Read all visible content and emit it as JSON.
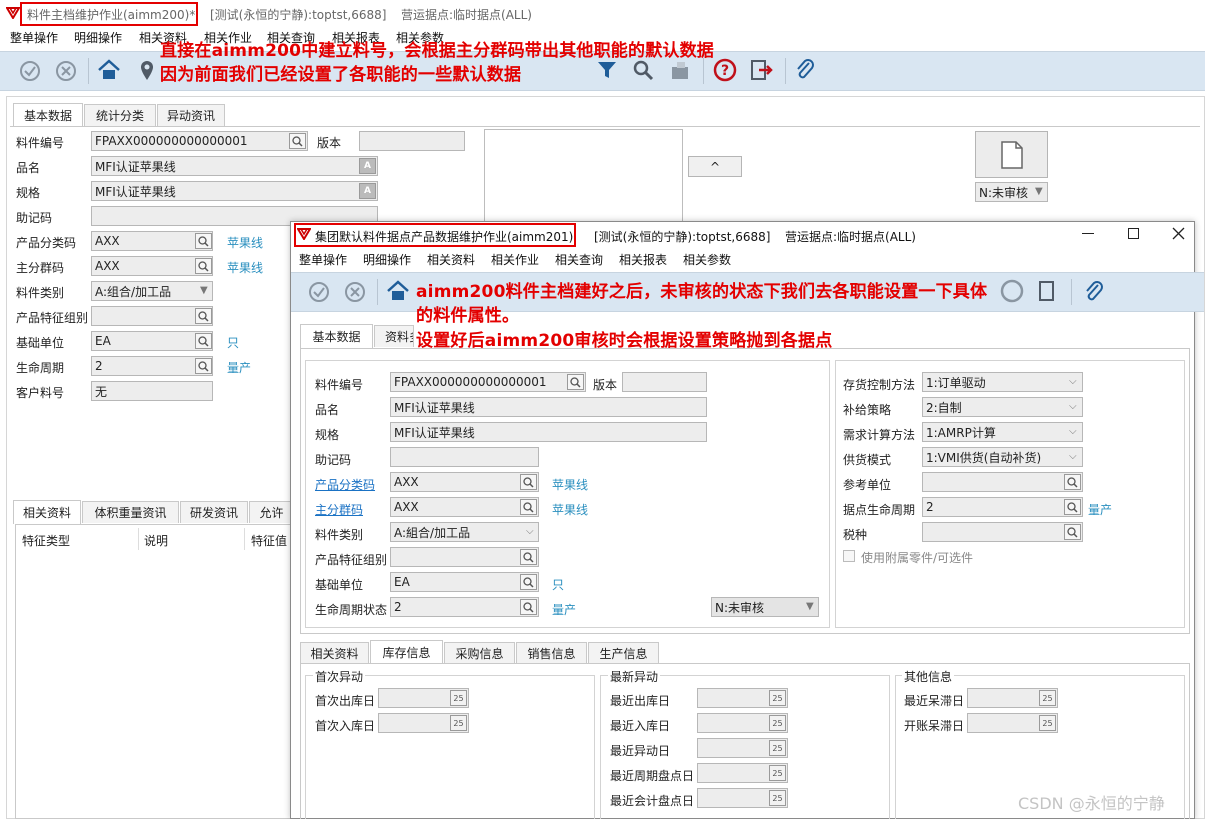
{
  "back_window": {
    "title": "料件主档维护作业(aimm200)*",
    "env": "[测试(永恒的宁静):toptst,6688]",
    "site": "营运据点:临时据点(ALL)",
    "menus": [
      "整单操作",
      "明细操作",
      "相关资料",
      "相关作业",
      "相关查询",
      "相关报表",
      "相关参数"
    ],
    "tabs": [
      "基本数据",
      "统计分类",
      "异动资讯"
    ],
    "fields": {
      "item_no_label": "料件编号",
      "item_no": "FPAXX000000000000001",
      "version_label": "版本",
      "name_label": "品名",
      "name": "MFI认证苹果线",
      "spec_label": "规格",
      "spec": "MFI认证苹果线",
      "mnemonic_label": "助记码",
      "prod_class_label": "产品分类码",
      "prod_class": "AXX",
      "prod_class_hint": "苹果线",
      "main_group_label": "主分群码",
      "main_group": "AXX",
      "main_group_hint": "苹果线",
      "item_type_label": "料件类别",
      "item_type": "A:组合/加工品",
      "feature_group_label": "产品特征组别",
      "base_unit_label": "基础单位",
      "base_unit": "EA",
      "base_unit_hint": "只",
      "lifecycle_label": "生命周期",
      "lifecycle": "2",
      "lifecycle_hint": "量产",
      "cust_item_label": "客户料号",
      "cust_item": "无"
    },
    "up_button": "^",
    "status": "N:未审核",
    "bottom_tabs": [
      "相关资料",
      "体积重量资讯",
      "研发资讯",
      "允许"
    ],
    "grid_headers": [
      "特征类型",
      "说明",
      "特征值"
    ]
  },
  "annotation_top": [
    "直接在aimm200中建立料号，会根据主分群码带出其他职能的默认数据",
    "因为前面我们已经设置了各职能的一些默认数据"
  ],
  "front_window": {
    "title": "集团默认料件据点产品数据维护作业(aimm201)",
    "env": "[测试(永恒的宁静):toptst,6688]",
    "site": "营运据点:临时据点(ALL)",
    "menus": [
      "整单操作",
      "明细操作",
      "相关资料",
      "相关作业",
      "相关查询",
      "相关报表",
      "相关参数"
    ],
    "tabs": [
      "基本数据",
      "资料多"
    ],
    "left": {
      "item_no_label": "料件编号",
      "item_no": "FPAXX000000000000001",
      "version_label": "版本",
      "name_label": "品名",
      "name": "MFI认证苹果线",
      "spec_label": "规格",
      "spec": "MFI认证苹果线",
      "mnemonic_label": "助记码",
      "prod_class_label": "产品分类码",
      "prod_class": "AXX",
      "prod_class_hint": "苹果线",
      "main_group_label": "主分群码",
      "main_group": "AXX",
      "main_group_hint": "苹果线",
      "item_type_label": "料件类别",
      "item_type": "A:組合/加工品",
      "feature_group_label": "产品特征组别",
      "base_unit_label": "基础单位",
      "base_unit": "EA",
      "base_unit_hint": "只",
      "lifecycle_label": "生命周期状态",
      "lifecycle": "2",
      "lifecycle_hint": "量产",
      "status": "N:未审核"
    },
    "right": {
      "inv_ctrl_label": "存货控制方法",
      "inv_ctrl": "1:订单驱动",
      "replenish_label": "补给策略",
      "replenish": "2:自制",
      "demand_label": "需求计算方法",
      "demand": "1:AMRP计算",
      "supply_label": "供货模式",
      "supply": "1:VMI供货(自动补货)",
      "ref_unit_label": "参考单位",
      "site_life_label": "据点生命周期",
      "site_life": "2",
      "site_life_hint": "量产",
      "tax_label": "税种",
      "use_parts_label": "使用附属零件/可选件"
    },
    "bottom_tabs": [
      "相关资料",
      "库存信息",
      "采购信息",
      "销售信息",
      "生产信息"
    ],
    "group_first": {
      "title": "首次异动",
      "rows": [
        "首次出库日",
        "首次入库日"
      ]
    },
    "group_latest": {
      "title": "最新异动",
      "rows": [
        "最近出库日",
        "最近入库日",
        "最近异动日",
        "最近周期盘点日",
        "最近会计盘点日"
      ]
    },
    "group_other": {
      "title": "其他信息",
      "rows": [
        "最近呆滞日",
        "开账呆滞日"
      ]
    },
    "calendar_glyph": "25"
  },
  "annotation_mid": [
    "aimm200料件主档建好之后，未审核的状态下我们去各职能设置一下具体",
    "的料件属性。",
    "设置好后aimm200审核时会根据设置策略抛到各据点"
  ],
  "watermark": "CSDN @永恒的宁静",
  "colors": {
    "annotation": "#e30000",
    "toolbar": "#d9e6f2",
    "hint": "#2a8fbf"
  }
}
